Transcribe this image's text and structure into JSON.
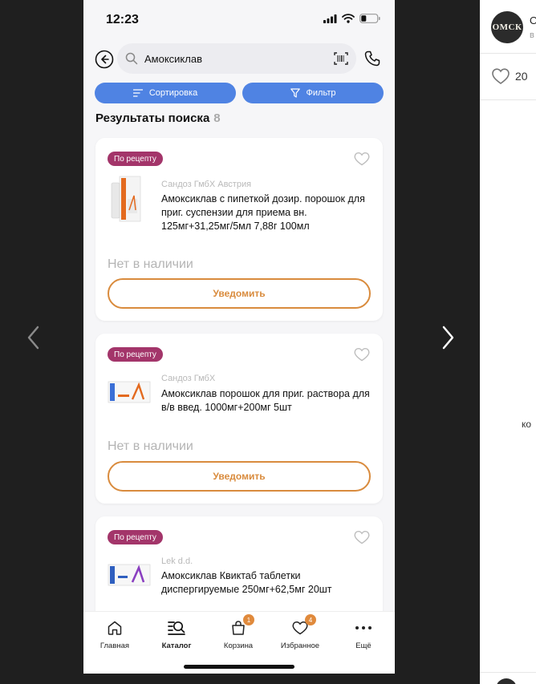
{
  "status": {
    "time": "12:23"
  },
  "search": {
    "value": "Амоксиклав"
  },
  "actions": {
    "sort": "Сортировка",
    "filter": "Фильтр"
  },
  "results": {
    "title": "Результаты поиска",
    "count": "8"
  },
  "products": [
    {
      "badge": "По рецепту",
      "maker": "Сандоз ГмбХ Австрия",
      "name": "Амоксиклав с пипеткой дозир. порошок для приг. суспензии для приема вн. 125мг+31,25мг/5мл 7,88г 100мл",
      "stock": "Нет в наличии",
      "notify": "Уведомить"
    },
    {
      "badge": "По рецепту",
      "maker": "Сандоз ГмбХ",
      "name": "Амоксиклав порошок для приг. раствора для в/в введ. 1000мг+200мг 5шт",
      "stock": "Нет в наличии",
      "notify": "Уведомить"
    },
    {
      "badge": "По рецепту",
      "maker": "Lek d.d.",
      "name": "Амоксиклав Квиктаб таблетки диспергируемые 250мг+62,5мг 20шт"
    }
  ],
  "tabs": [
    {
      "label": "Главная",
      "icon": "home-icon"
    },
    {
      "label": "Каталог",
      "icon": "catalog-search-icon",
      "active": true
    },
    {
      "label": "Корзина",
      "icon": "cart-icon",
      "badge": "1"
    },
    {
      "label": "Избранное",
      "icon": "heart-icon",
      "badge": "4"
    },
    {
      "label": "Ещё",
      "icon": "more-icon"
    }
  ],
  "side": {
    "avatar_text": "ОМСК",
    "head_name": "О",
    "head_sub": "в",
    "likes": "20",
    "text": "ко"
  },
  "colors": {
    "accent_blue": "#4f83e3",
    "badge_purple": "#a3356a",
    "notify_orange": "#d98b3d"
  }
}
